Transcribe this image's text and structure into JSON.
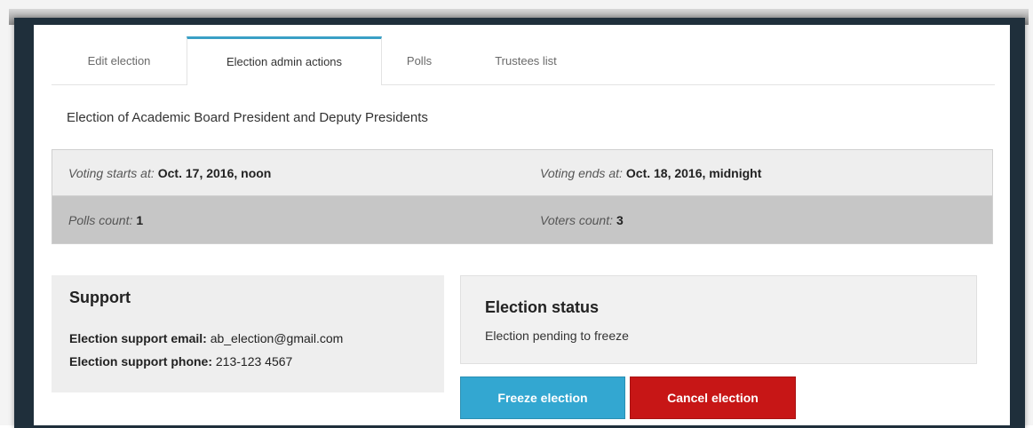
{
  "tabs": [
    {
      "label": "Edit election",
      "active": false
    },
    {
      "label": "Election admin actions",
      "active": true
    },
    {
      "label": "Polls",
      "active": false
    },
    {
      "label": "Trustees list",
      "active": false
    }
  ],
  "election": {
    "title": "Election of Academic Board President and Deputy Presidents"
  },
  "info": {
    "voting_starts_label": "Voting starts at:",
    "voting_starts_value": "Oct. 17, 2016, noon",
    "voting_ends_label": "Voting ends at:",
    "voting_ends_value": "Oct. 18, 2016, midnight",
    "polls_count_label": "Polls count:",
    "polls_count_value": "1",
    "voters_count_label": "Voters count:",
    "voters_count_value": "3"
  },
  "support": {
    "heading": "Support",
    "email_label": "Election support email:",
    "email_value": "ab_election@gmail.com",
    "phone_label": "Election support phone:",
    "phone_value": "213-123 4567"
  },
  "status": {
    "heading": "Election status",
    "text": "Election pending to freeze"
  },
  "actions": {
    "freeze_label": "Freeze election",
    "cancel_label": "Cancel election"
  },
  "colors": {
    "accent": "#3aa0c6",
    "freeze_button": "#33a7d1",
    "cancel_button": "#c71616",
    "frame": "#1f2f3b"
  }
}
